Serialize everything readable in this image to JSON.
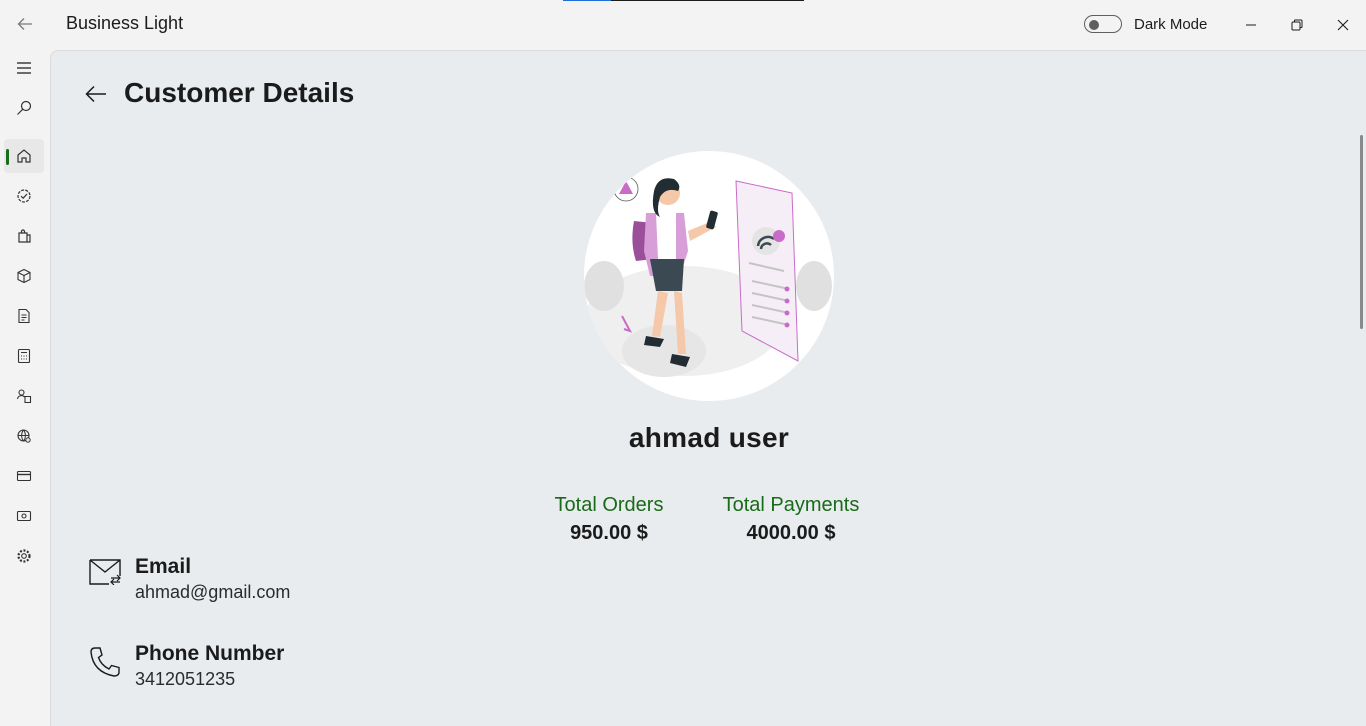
{
  "app": {
    "title": "Business Light",
    "dark_mode_label": "Dark Mode",
    "dark_mode_on": false
  },
  "nav": {
    "items": [
      {
        "icon": "hamburger-menu-icon"
      },
      {
        "icon": "search-icon"
      },
      {
        "icon": "home-icon",
        "selected": true
      },
      {
        "icon": "check-badge-icon"
      },
      {
        "icon": "shopping-bag-icon"
      },
      {
        "icon": "box-icon"
      },
      {
        "icon": "document-icon"
      },
      {
        "icon": "calculator-icon"
      },
      {
        "icon": "people-icon"
      },
      {
        "icon": "globe-icon"
      },
      {
        "icon": "credit-card-icon"
      },
      {
        "icon": "money-icon"
      },
      {
        "icon": "settings-icon"
      }
    ],
    "accent": "#1a6b1a"
  },
  "page": {
    "title": "Customer Details"
  },
  "customer": {
    "name": "ahmad user",
    "stats": [
      {
        "label": "Total Orders",
        "value": "950.00 $"
      },
      {
        "label": "Total Payments",
        "value": "4000.00 $"
      }
    ],
    "email": {
      "label": "Email",
      "value": "ahmad@gmail.com"
    },
    "phone": {
      "label": "Phone Number",
      "value": "3412051235"
    }
  },
  "colors": {
    "stat_label": "#196a19",
    "content_bg": "#e8ecef"
  }
}
